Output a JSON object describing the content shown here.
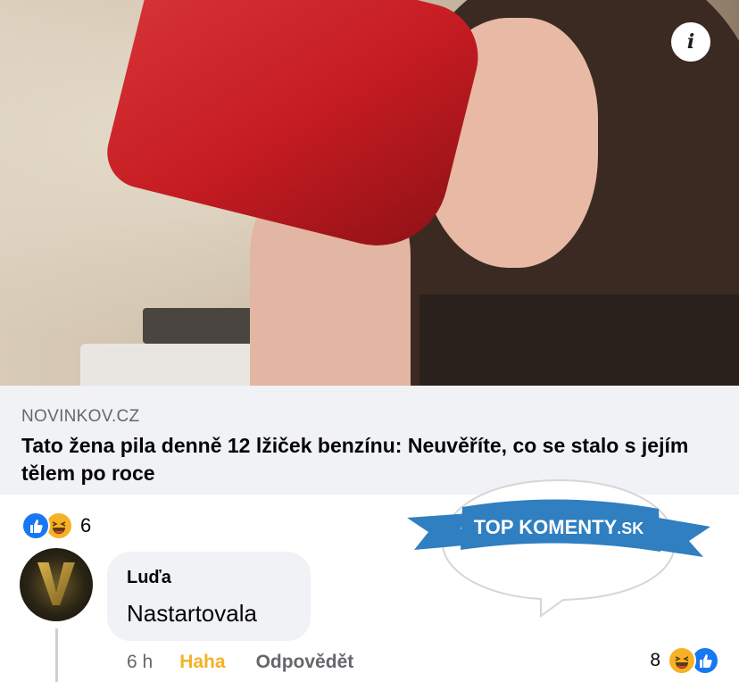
{
  "post": {
    "link": {
      "domain": "NOVINKOV.CZ",
      "title": "Tato žena pila denně 12 lžiček benzínu: Neuvěříte, co se stalo s jejím tělem po roce"
    },
    "reactions": {
      "types": [
        "like-icon",
        "haha-icon"
      ],
      "count": "6"
    }
  },
  "watermark": {
    "text_top": "TOP KOMENTY",
    "text_suffix": ".SK"
  },
  "comment": {
    "author": "Luďa",
    "text": "Nastartovala",
    "time": "6 h",
    "reaction_action": "Haha",
    "reply_action": "Odpovědět",
    "reaction_count": "8",
    "reaction_types": [
      "haha-icon",
      "like-icon"
    ]
  },
  "colors": {
    "like": "#1877f2",
    "haha": "#f7b125",
    "banner": "#2f7fc1",
    "muted": "#65676b"
  }
}
